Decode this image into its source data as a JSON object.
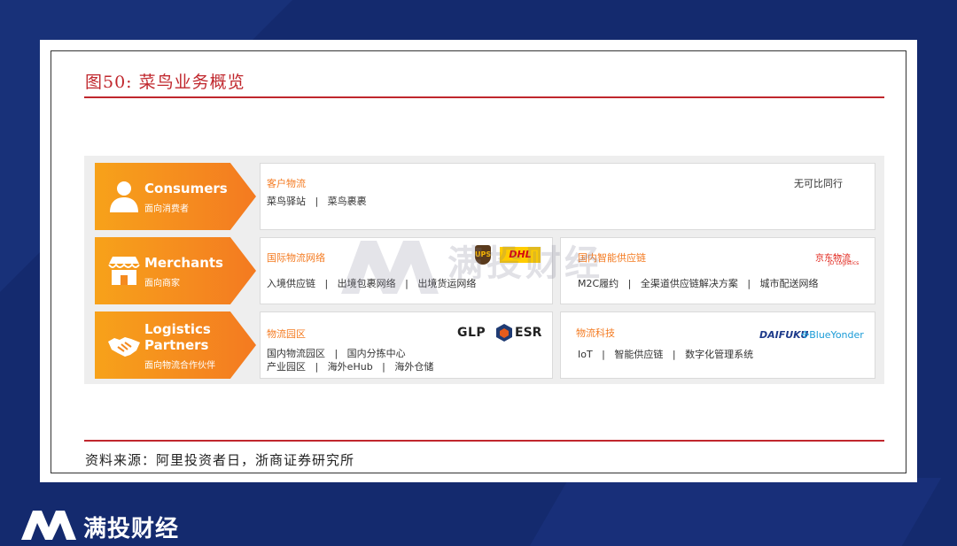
{
  "figure": {
    "title": "图50:  菜鸟业务概览",
    "source": "资料来源：阿里投资者日，浙商证券研究所"
  },
  "rows": [
    {
      "label_en": "Consumers",
      "label_cn": "面向消费者",
      "icon": "person-icon",
      "panels": [
        {
          "title": "客户物流",
          "line1": "菜鸟驿站   |   菜鸟裹裹",
          "right_text": "无可比同行"
        }
      ]
    },
    {
      "label_en": "Merchants",
      "label_cn": "面向商家",
      "icon": "store-icon",
      "panels": [
        {
          "title": "国际物流网络",
          "line1": "入境供应链   |   出境包裹网络   |   出境货运网络",
          "logos": [
            "UPS",
            "DHL"
          ]
        },
        {
          "title": "国内智能供应链",
          "line1": "M2C履约   |   全渠道供应链解决方案   |   城市配送网络",
          "logos": [
            "京东物流",
            "JD Logistics"
          ]
        }
      ]
    },
    {
      "label_en_1": "Logistics",
      "label_en_2": "Partners",
      "label_cn": "面向物流合作伙伴",
      "icon": "handshake-icon",
      "panels": [
        {
          "title": "物流园区",
          "line1": "国内物流园区   |   国内分拣中心",
          "line2": "产业园区   |   海外eHub   |   海外仓储",
          "logos": [
            "GLP",
            "ESR"
          ]
        },
        {
          "title": "物流科技",
          "line1": "IoT   |   智能供应链   |   数字化管理系统",
          "logos": [
            "DAIFUKU",
            "BlueYonder"
          ]
        }
      ]
    }
  ],
  "watermark": "满投财经",
  "brand": {
    "name": "满投财经"
  },
  "colors": {
    "accent_red": "#c0272d",
    "arrow_orange": "#f58a1f",
    "background_navy": "#142a6e"
  }
}
